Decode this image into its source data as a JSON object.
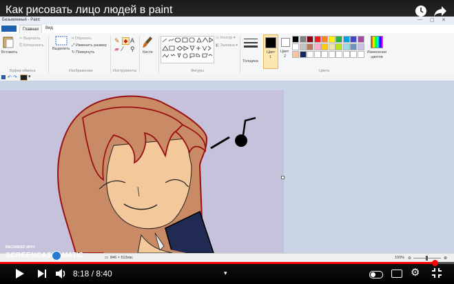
{
  "video": {
    "title": "Как рисовать лицо людей в paint",
    "time_current": "8:18",
    "time_total": "8:40",
    "progress": 0.958
  },
  "paint": {
    "window_title": "Безымянный - Paint",
    "tabs": [
      "Главная",
      "Вид"
    ],
    "clipboard": {
      "paste": "Вставить",
      "cut": "Вырезать",
      "copy": "Копировать",
      "group": "Буфер обмена"
    },
    "image": {
      "crop": "Обрезать",
      "select": "Выделить",
      "resize": "Изменить размер",
      "rotate": "Повернуть",
      "group": "Изображение"
    },
    "tools": {
      "group": "Инструменты"
    },
    "brushes": {
      "label": "Кисти"
    },
    "shapes": {
      "outline": "Контур",
      "fill": "Заливка",
      "group": "Фигуры"
    },
    "size_label": "Толщина",
    "color1": {
      "label": "Цвет",
      "num": "1"
    },
    "color2": {
      "label": "Цвет",
      "num": "2"
    },
    "edit_colors": "Изменение цветов",
    "colors_group": "Цвета",
    "status": {
      "dimensions": "846 × 513пкс",
      "zoom": "100%"
    },
    "palette_row1": [
      "#000000",
      "#7f7f7f",
      "#880015",
      "#ed1c24",
      "#ff7f27",
      "#fff200",
      "#22b14c",
      "#00a2e8",
      "#3f48cc",
      "#a349a4"
    ],
    "palette_row2": [
      "#ffffff",
      "#c3c3c3",
      "#b97a57",
      "#ffaec9",
      "#ffc90e",
      "#efe4b0",
      "#b5e61d",
      "#99d9ea",
      "#7092be",
      "#c8bfe7"
    ]
  },
  "watermark": {
    "line1": "RECORDED WITH",
    "line2": "SCREENCAST",
    "line3": "MATIC"
  }
}
